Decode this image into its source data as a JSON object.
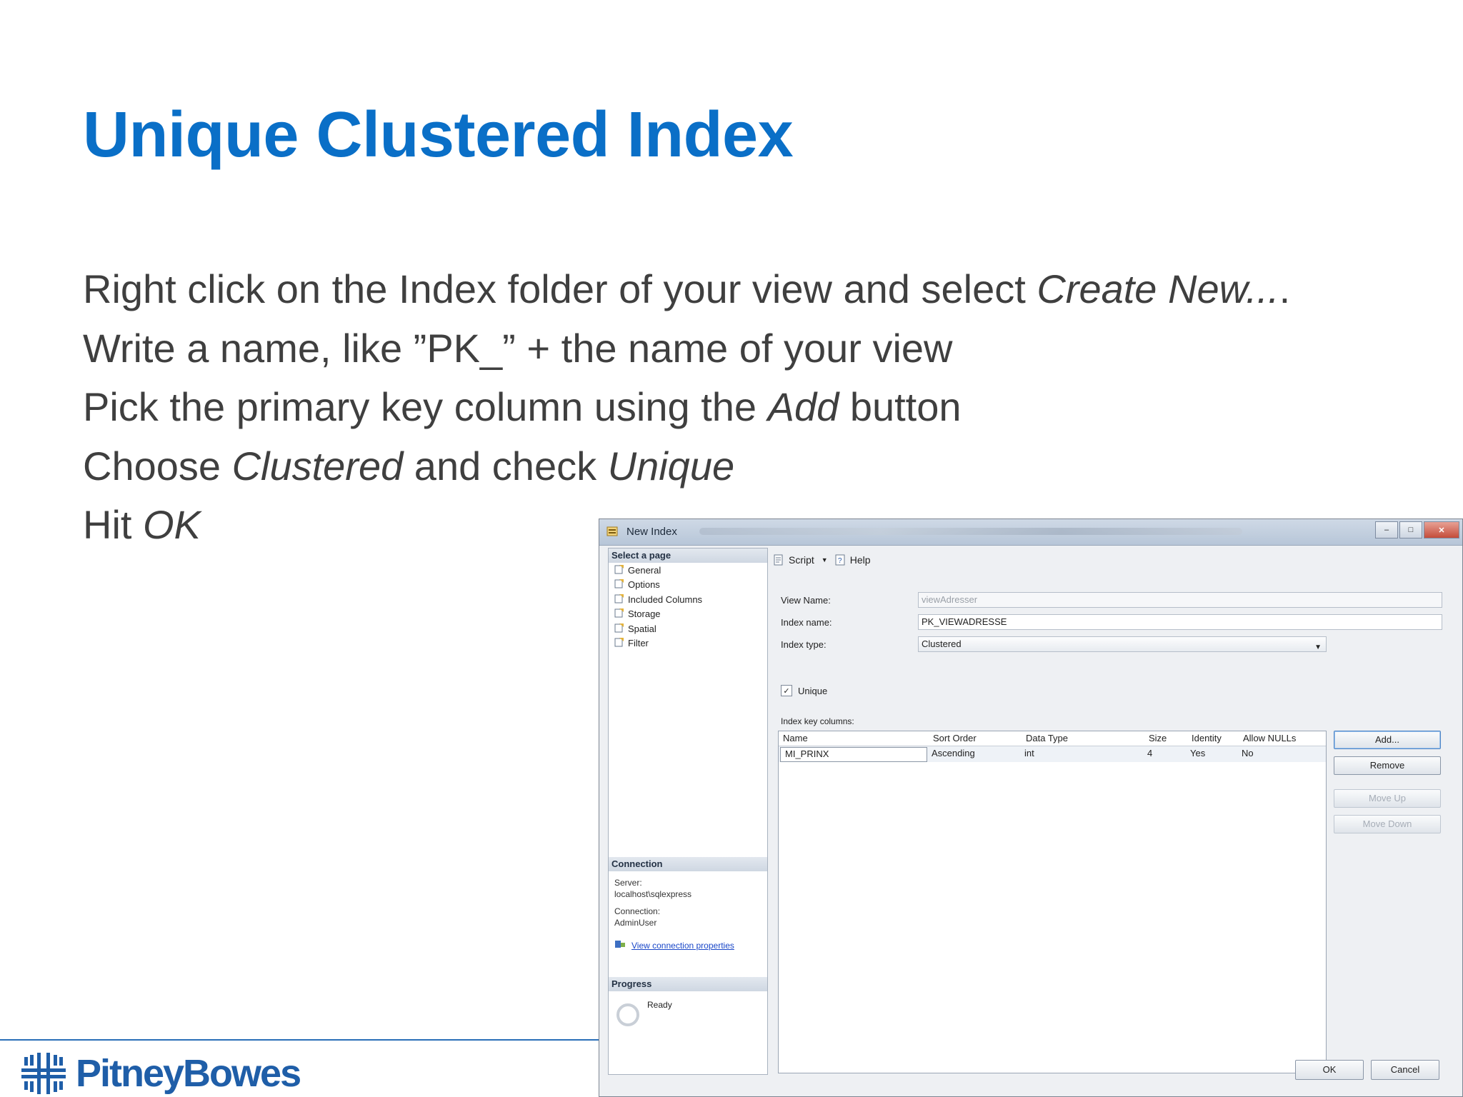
{
  "slide": {
    "title": "Unique Clustered Index",
    "bullets": [
      {
        "text_a": "Right click on the Index folder of your view and select ",
        "em": "Create New...",
        "text_b": "."
      },
      {
        "text_a": "Write a name, like ”PK_” + the name of your view"
      },
      {
        "text_a": "Pick the primary key column using the ",
        "em": "Add",
        "text_b": " button"
      },
      {
        "text_a": "Choose ",
        "em": "Clustered",
        "text_b": " and check ",
        "em2": "Unique"
      },
      {
        "text_a": "Hit ",
        "em": "OK"
      }
    ],
    "logo_text": "PitneyBowes"
  },
  "dialog": {
    "title": "New Index",
    "window_buttons": {
      "minimize": "–",
      "maximize": "□",
      "close": "✕"
    },
    "select_page_header": "Select a page",
    "pages": [
      "General",
      "Options",
      "Included Columns",
      "Storage",
      "Spatial",
      "Filter"
    ],
    "connection_header": "Connection",
    "server_label": "Server:",
    "server_value": "localhost\\sqlexpress",
    "connection_label": "Connection:",
    "connection_value": "AdminUser",
    "view_connection_link": "View connection properties",
    "progress_header": "Progress",
    "progress_status": "Ready",
    "toolbar": {
      "script": "Script",
      "help": "Help"
    },
    "form": {
      "view_name_label": "View Name:",
      "view_name_value": "viewAdresser",
      "index_name_label": "Index name:",
      "index_name_value": "PK_VIEWADRESSE",
      "index_type_label": "Index type:",
      "index_type_value": "Clustered",
      "unique_label": "Unique",
      "unique_checked": true,
      "key_columns_label": "Index key columns:"
    },
    "table": {
      "columns": [
        "Name",
        "Sort Order",
        "Data Type",
        "Size",
        "Identity",
        "Allow NULLs"
      ],
      "rows": [
        [
          "MI_PRINX",
          "Ascending",
          "int",
          "4",
          "Yes",
          "No"
        ]
      ]
    },
    "buttons": {
      "add": "Add...",
      "remove": "Remove",
      "move_up": "Move Up",
      "move_down": "Move Down",
      "ok": "OK",
      "cancel": "Cancel"
    }
  }
}
